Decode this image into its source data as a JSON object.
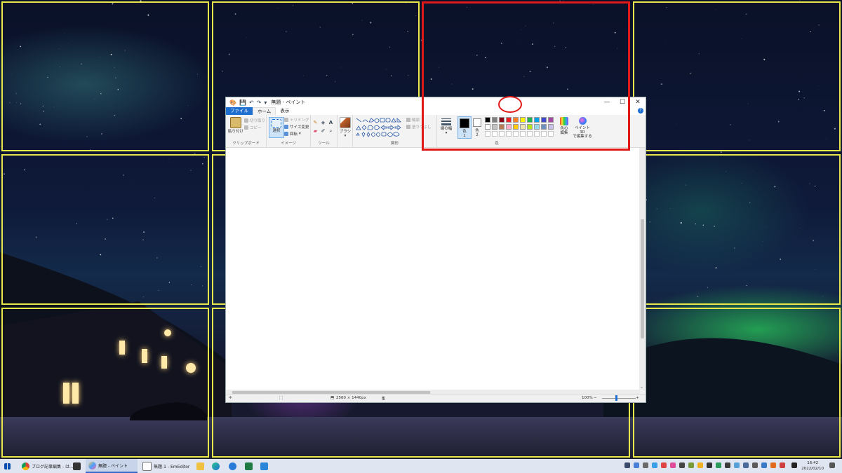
{
  "window": {
    "title": "無題 - ペイント",
    "minimize": "—",
    "maximize": "☐",
    "close": "✕"
  },
  "menu": {
    "file": "ファイル",
    "home": "ホーム",
    "view": "表示",
    "help": "?"
  },
  "ribbon": {
    "clipboard": {
      "group": "クリップボード",
      "paste": "貼り付け",
      "cut": "切り取り",
      "copy": "コピー"
    },
    "image": {
      "group": "イメージ",
      "select": "選択",
      "crop": "トリミング",
      "resize": "サイズ変更",
      "rotate": "回転"
    },
    "tools": {
      "group": "ツール"
    },
    "brush": {
      "label": "ブラシ"
    },
    "shapes": {
      "group": "図形",
      "outline": "輪郭",
      "fill": "塗りつぶし"
    },
    "size": {
      "label": "線の幅"
    },
    "colors": {
      "group": "色",
      "color1": "色",
      "color1_num": "1",
      "color2": "色",
      "color2_num": "2",
      "edit_colors_1": "色の",
      "edit_colors_2": "編集",
      "paint3d_1": "ペイント 3D",
      "paint3d_2": "で編集する",
      "palette_row1": [
        "#000000",
        "#7f7f7f",
        "#880015",
        "#ed1c24",
        "#ff7f27",
        "#fff200",
        "#22b14c",
        "#00a2e8",
        "#3f48cc",
        "#a349a4"
      ],
      "palette_row2": [
        "#ffffff",
        "#c3c3c3",
        "#b97a57",
        "#ffaec9",
        "#ffc90e",
        "#efe4b0",
        "#b5e61d",
        "#99d9ea",
        "#7092be",
        "#c8bfe7"
      ]
    }
  },
  "status": {
    "dimensions": "2560 × 1440px",
    "zoom": "100%",
    "zoom_minus": "−",
    "zoom_plus": "+"
  },
  "taskbar": {
    "chrome": "ブログ記事編集 - は...",
    "paint": "無題 - ペイント",
    "emeditor": "無題-1 - EmEditor",
    "time": "16:42",
    "date": "2022/02/10"
  },
  "accent_colors": {
    "grid": "#e8e84a",
    "highlight": "#e01818",
    "file_tab": "#1e6fd0"
  }
}
